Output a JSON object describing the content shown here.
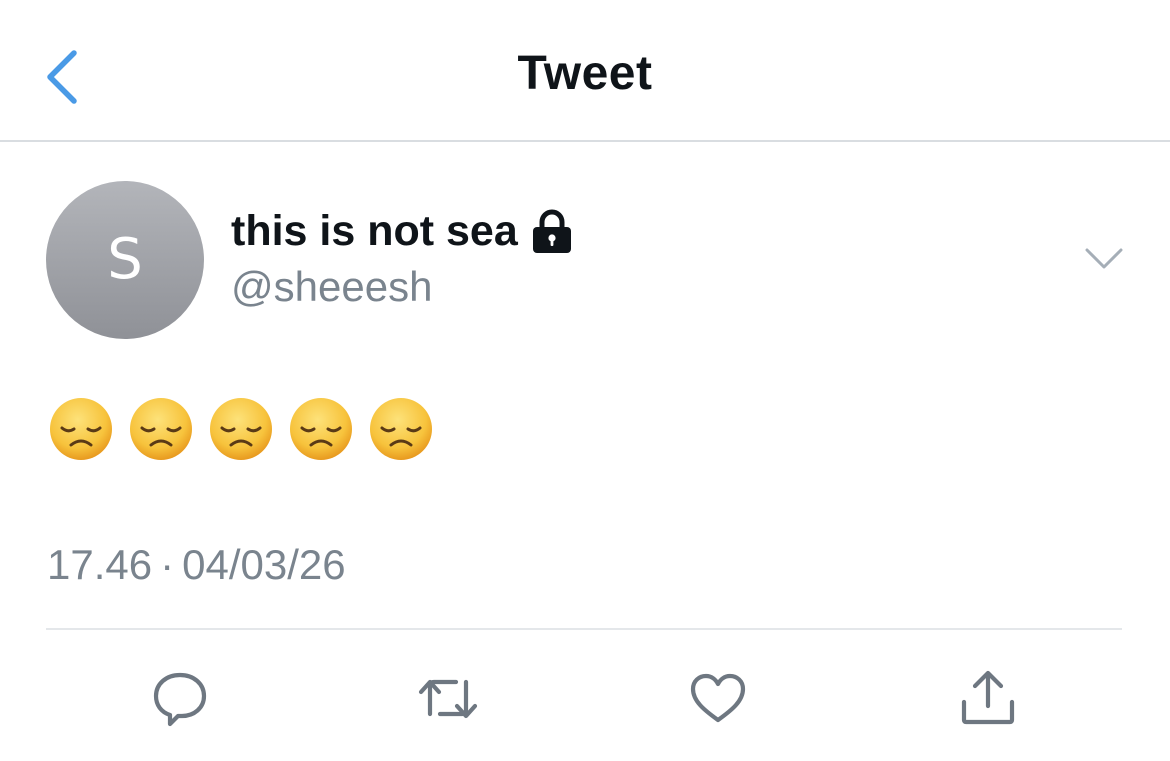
{
  "header": {
    "title": "Tweet",
    "back_icon": "chevron-left-icon",
    "back_color": "#4a9ae6"
  },
  "author": {
    "avatar_letter": "S",
    "display_name": "this is not sea",
    "protected_icon": "lock-icon",
    "handle": "@sheeesh",
    "menu_icon": "chevron-down-icon"
  },
  "tweet": {
    "text_emoji": [
      "disappointed-face",
      "disappointed-face",
      "disappointed-face",
      "disappointed-face",
      "disappointed-face"
    ],
    "time": "17.46",
    "separator": "·",
    "date": "04/03/26"
  },
  "actions": [
    {
      "name": "reply",
      "icon": "comment-bubble-icon"
    },
    {
      "name": "retweet",
      "icon": "retweet-icon"
    },
    {
      "name": "like",
      "icon": "heart-icon"
    },
    {
      "name": "share",
      "icon": "share-icon"
    }
  ],
  "colors": {
    "text_primary": "#0f1419",
    "text_secondary": "#7a848e",
    "accent": "#4a9ae6",
    "icon_gray": "#6e7781",
    "divider": "#e4e7ea",
    "avatar": "#a3a5aa",
    "emoji_yellow": "#f7c33c"
  }
}
